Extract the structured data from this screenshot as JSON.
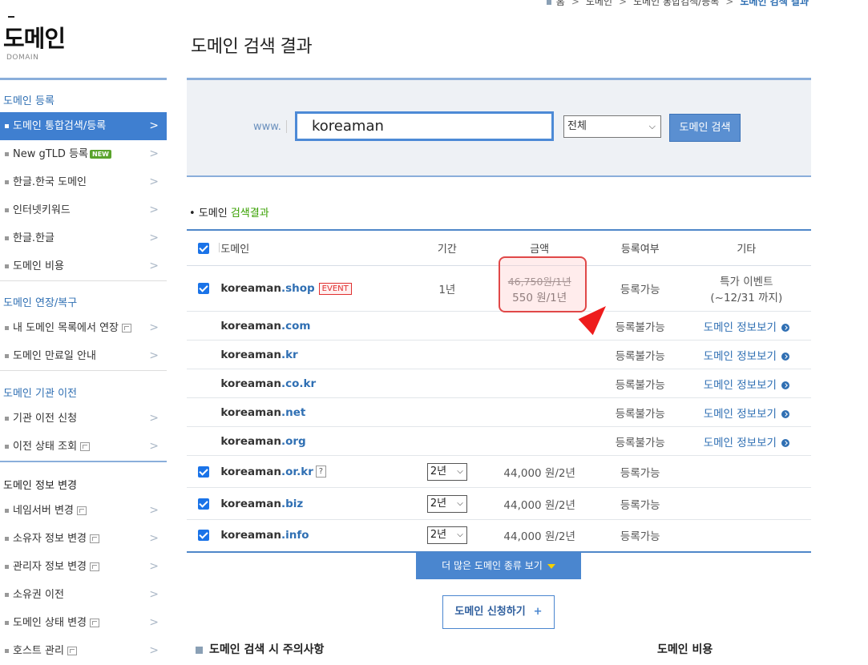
{
  "breadcrumb": [
    "홈",
    "도메인",
    "도메인 통합검색/등록",
    "도메인 검색 결과"
  ],
  "lnb": {
    "title": "도메인",
    "subtitle": "DOMAIN",
    "groups": [
      {
        "title": "도메인 등록",
        "items": [
          {
            "label": "도메인 통합검색/등록"
          },
          {
            "label": "New gTLD 등록",
            "badge": "NEW"
          },
          {
            "label": "한글.한국 도메인"
          },
          {
            "label": "인터넷키워드"
          },
          {
            "label": "한글.한글"
          },
          {
            "label": "도메인 비용"
          }
        ]
      },
      {
        "title": "도메인 연장/복구",
        "items": [
          {
            "label": "내 도메인 목록에서 연장"
          },
          {
            "label": "도메인 만료일 안내"
          }
        ]
      },
      {
        "title": "도메인 기관 이전",
        "items": [
          {
            "label": "기관 이전 신청"
          },
          {
            "label": "이전 상태 조회"
          }
        ]
      },
      {
        "title": "도메인 정보 변경",
        "items": [
          {
            "label": "네임서버 변경"
          },
          {
            "label": "소유자 정보 변경"
          },
          {
            "label": "관리자 정보 변경"
          },
          {
            "label": "소유권 이전"
          },
          {
            "label": "도메인 상태 변경"
          },
          {
            "label": "호스트 관리"
          }
        ]
      }
    ]
  },
  "page_title": "도메인 검색 결과",
  "search": {
    "prefix": "www.",
    "value": "koreaman",
    "scope": "전체",
    "button": "도메인 검색"
  },
  "results": {
    "heading_prefix": "도메인",
    "heading_highlight": "검색결과",
    "columns": [
      "도메인",
      "기간",
      "금액",
      "등록여부",
      "기타"
    ],
    "rows": [
      {
        "name": "koreaman",
        "ext": ".shop",
        "badge": "EVENT",
        "period": "1년",
        "price_old": "46,750원/1년",
        "price": "550 원/1년",
        "status": "등록가능",
        "etc_line1": "특가 이벤트",
        "etc_line2": "(~12/31 까지)"
      },
      {
        "name": "koreaman",
        "ext": ".com",
        "status": "등록불가능",
        "etc": "도메인 정보보기"
      },
      {
        "name": "koreaman",
        "ext": ".kr",
        "status": "등록불가능",
        "etc": "도메인 정보보기"
      },
      {
        "name": "koreaman",
        "ext": ".co.kr",
        "status": "등록불가능",
        "etc": "도메인 정보보기"
      },
      {
        "name": "koreaman",
        "ext": ".net",
        "status": "등록불가능",
        "etc": "도메인 정보보기"
      },
      {
        "name": "koreaman",
        "ext": ".org",
        "status": "등록불가능",
        "etc": "도메인 정보보기"
      },
      {
        "name": "koreaman",
        "ext": ".or.kr",
        "help": "?",
        "period": "2년",
        "price": "44,000 원/2년",
        "status": "등록가능"
      },
      {
        "name": "koreaman",
        "ext": ".biz",
        "period": "2년",
        "price": "44,000 원/2년",
        "status": "등록가능"
      },
      {
        "name": "koreaman",
        "ext": ".info",
        "period": "2년",
        "price": "44,000 원/2년",
        "status": "등록가능"
      }
    ]
  },
  "more_button": "더 많은 도메인 종류 보기",
  "apply_button": "도메인 신청하기",
  "apply_plus": "+",
  "bottom": {
    "left_title": "도메인 검색 시 주의사항",
    "right_title": "도메인 비용"
  },
  "colors": {
    "accent": "#3f7fd0",
    "available": "#38a000",
    "unavailable": "#e02020",
    "highlight": "#e04848"
  }
}
